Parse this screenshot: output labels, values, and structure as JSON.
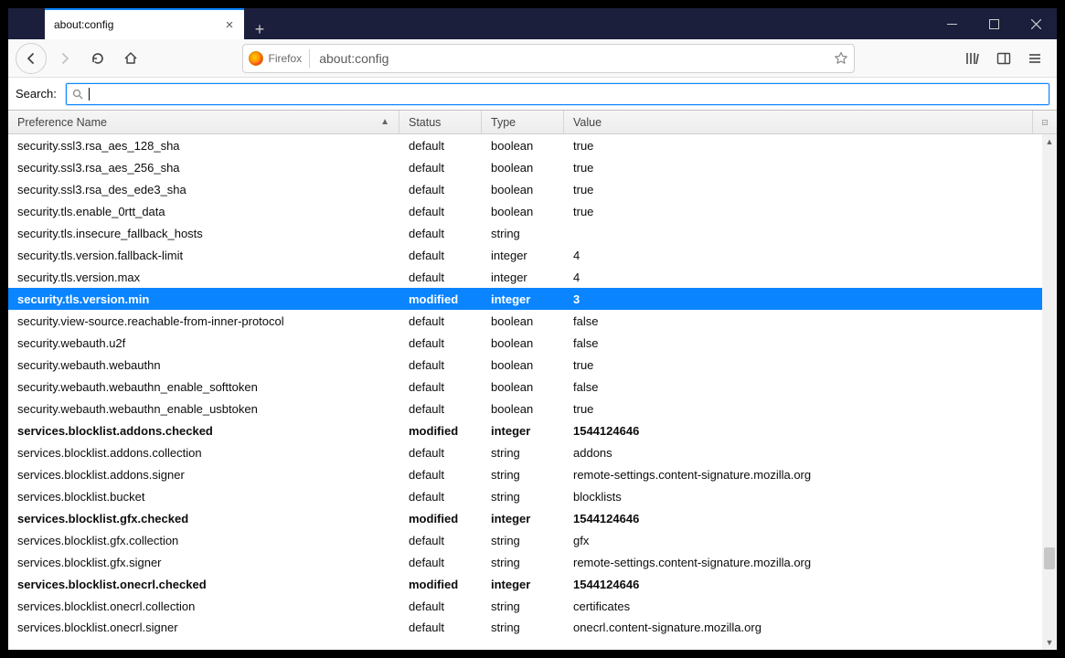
{
  "window": {
    "tab_title": "about:config",
    "newtab": "+"
  },
  "nav": {
    "identity_label": "Firefox",
    "url": "about:config"
  },
  "search": {
    "label": "Search:",
    "placeholder": ""
  },
  "columns": {
    "name": "Preference Name",
    "status": "Status",
    "type": "Type",
    "value": "Value"
  },
  "rows": [
    {
      "name": "security.ssl3.rsa_aes_128_sha",
      "status": "default",
      "type": "boolean",
      "value": "true",
      "modified": false,
      "selected": false
    },
    {
      "name": "security.ssl3.rsa_aes_256_sha",
      "status": "default",
      "type": "boolean",
      "value": "true",
      "modified": false,
      "selected": false
    },
    {
      "name": "security.ssl3.rsa_des_ede3_sha",
      "status": "default",
      "type": "boolean",
      "value": "true",
      "modified": false,
      "selected": false
    },
    {
      "name": "security.tls.enable_0rtt_data",
      "status": "default",
      "type": "boolean",
      "value": "true",
      "modified": false,
      "selected": false
    },
    {
      "name": "security.tls.insecure_fallback_hosts",
      "status": "default",
      "type": "string",
      "value": "",
      "modified": false,
      "selected": false
    },
    {
      "name": "security.tls.version.fallback-limit",
      "status": "default",
      "type": "integer",
      "value": "4",
      "modified": false,
      "selected": false
    },
    {
      "name": "security.tls.version.max",
      "status": "default",
      "type": "integer",
      "value": "4",
      "modified": false,
      "selected": false
    },
    {
      "name": "security.tls.version.min",
      "status": "modified",
      "type": "integer",
      "value": "3",
      "modified": true,
      "selected": true
    },
    {
      "name": "security.view-source.reachable-from-inner-protocol",
      "status": "default",
      "type": "boolean",
      "value": "false",
      "modified": false,
      "selected": false
    },
    {
      "name": "security.webauth.u2f",
      "status": "default",
      "type": "boolean",
      "value": "false",
      "modified": false,
      "selected": false
    },
    {
      "name": "security.webauth.webauthn",
      "status": "default",
      "type": "boolean",
      "value": "true",
      "modified": false,
      "selected": false
    },
    {
      "name": "security.webauth.webauthn_enable_softtoken",
      "status": "default",
      "type": "boolean",
      "value": "false",
      "modified": false,
      "selected": false
    },
    {
      "name": "security.webauth.webauthn_enable_usbtoken",
      "status": "default",
      "type": "boolean",
      "value": "true",
      "modified": false,
      "selected": false
    },
    {
      "name": "services.blocklist.addons.checked",
      "status": "modified",
      "type": "integer",
      "value": "1544124646",
      "modified": true,
      "selected": false
    },
    {
      "name": "services.blocklist.addons.collection",
      "status": "default",
      "type": "string",
      "value": "addons",
      "modified": false,
      "selected": false
    },
    {
      "name": "services.blocklist.addons.signer",
      "status": "default",
      "type": "string",
      "value": "remote-settings.content-signature.mozilla.org",
      "modified": false,
      "selected": false
    },
    {
      "name": "services.blocklist.bucket",
      "status": "default",
      "type": "string",
      "value": "blocklists",
      "modified": false,
      "selected": false
    },
    {
      "name": "services.blocklist.gfx.checked",
      "status": "modified",
      "type": "integer",
      "value": "1544124646",
      "modified": true,
      "selected": false
    },
    {
      "name": "services.blocklist.gfx.collection",
      "status": "default",
      "type": "string",
      "value": "gfx",
      "modified": false,
      "selected": false
    },
    {
      "name": "services.blocklist.gfx.signer",
      "status": "default",
      "type": "string",
      "value": "remote-settings.content-signature.mozilla.org",
      "modified": false,
      "selected": false
    },
    {
      "name": "services.blocklist.onecrl.checked",
      "status": "modified",
      "type": "integer",
      "value": "1544124646",
      "modified": true,
      "selected": false
    },
    {
      "name": "services.blocklist.onecrl.collection",
      "status": "default",
      "type": "string",
      "value": "certificates",
      "modified": false,
      "selected": false
    },
    {
      "name": "services.blocklist.onecrl.signer",
      "status": "default",
      "type": "string",
      "value": "onecrl.content-signature.mozilla.org",
      "modified": false,
      "selected": false,
      "cut": true
    }
  ]
}
